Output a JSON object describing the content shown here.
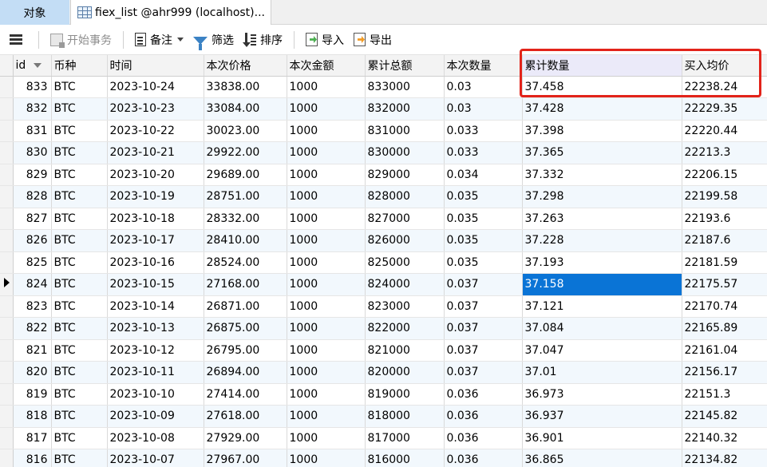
{
  "tabs": {
    "objects_label": "对象",
    "table_tab_label": "fiex_list @ahr999 (localhost)..."
  },
  "toolbar": {
    "begin_transaction_label": "开始事务",
    "note_label": "备注",
    "filter_label": "筛选",
    "sort_label": "排序",
    "import_label": "导入",
    "export_label": "导出"
  },
  "columns": [
    "id",
    "币种",
    "时间",
    "本次价格",
    "本次金额",
    "累计总额",
    "本次数量",
    "累计数量",
    "买入均价"
  ],
  "rows": [
    [
      "833",
      "BTC",
      "2023-10-24",
      "33838.00",
      "1000",
      "833000",
      "0.03",
      "37.458",
      "22238.24"
    ],
    [
      "832",
      "BTC",
      "2023-10-23",
      "33084.00",
      "1000",
      "832000",
      "0.03",
      "37.428",
      "22229.35"
    ],
    [
      "831",
      "BTC",
      "2023-10-22",
      "30023.00",
      "1000",
      "831000",
      "0.033",
      "37.398",
      "22220.44"
    ],
    [
      "830",
      "BTC",
      "2023-10-21",
      "29922.00",
      "1000",
      "830000",
      "0.033",
      "37.365",
      "22213.3"
    ],
    [
      "829",
      "BTC",
      "2023-10-20",
      "29689.00",
      "1000",
      "829000",
      "0.034",
      "37.332",
      "22206.15"
    ],
    [
      "828",
      "BTC",
      "2023-10-19",
      "28751.00",
      "1000",
      "828000",
      "0.035",
      "37.298",
      "22199.58"
    ],
    [
      "827",
      "BTC",
      "2023-10-18",
      "28332.00",
      "1000",
      "827000",
      "0.035",
      "37.263",
      "22193.6"
    ],
    [
      "826",
      "BTC",
      "2023-10-17",
      "28410.00",
      "1000",
      "826000",
      "0.035",
      "37.228",
      "22187.6"
    ],
    [
      "825",
      "BTC",
      "2023-10-16",
      "28524.00",
      "1000",
      "825000",
      "0.035",
      "37.193",
      "22181.59"
    ],
    [
      "824",
      "BTC",
      "2023-10-15",
      "27168.00",
      "1000",
      "824000",
      "0.037",
      "37.158",
      "22175.57"
    ],
    [
      "823",
      "BTC",
      "2023-10-14",
      "26871.00",
      "1000",
      "823000",
      "0.037",
      "37.121",
      "22170.74"
    ],
    [
      "822",
      "BTC",
      "2023-10-13",
      "26875.00",
      "1000",
      "822000",
      "0.037",
      "37.084",
      "22165.89"
    ],
    [
      "821",
      "BTC",
      "2023-10-12",
      "26795.00",
      "1000",
      "821000",
      "0.037",
      "37.047",
      "22161.04"
    ],
    [
      "820",
      "BTC",
      "2023-10-11",
      "26894.00",
      "1000",
      "820000",
      "0.037",
      "37.01",
      "22156.17"
    ],
    [
      "819",
      "BTC",
      "2023-10-10",
      "27414.00",
      "1000",
      "819000",
      "0.036",
      "36.973",
      "22151.3"
    ],
    [
      "818",
      "BTC",
      "2023-10-09",
      "27618.00",
      "1000",
      "818000",
      "0.036",
      "36.937",
      "22145.82"
    ],
    [
      "817",
      "BTC",
      "2023-10-08",
      "27929.00",
      "1000",
      "817000",
      "0.036",
      "36.901",
      "22140.32"
    ],
    [
      "816",
      "BTC",
      "2023-10-07",
      "27967.00",
      "1000",
      "816000",
      "0.036",
      "36.865",
      "22134.82"
    ]
  ],
  "current_row_id": "824",
  "selected_column": "累计数量",
  "colors": {
    "selection": "#0a74d6",
    "annotation": "#e2231a",
    "alt_row": "#f2f8fd"
  }
}
